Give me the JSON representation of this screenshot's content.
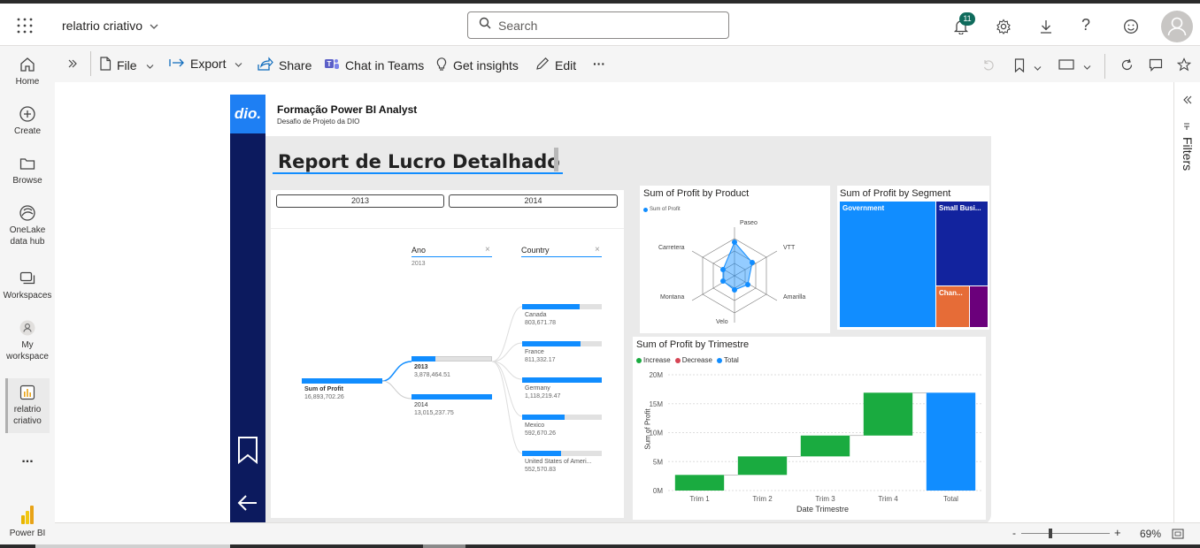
{
  "topbar": {
    "report_name": "relatrio criativo",
    "search_placeholder": "Search",
    "notification_count": "11"
  },
  "nav": {
    "items": [
      {
        "label": "Home"
      },
      {
        "label": "Create"
      },
      {
        "label": "Browse"
      },
      {
        "label": "OneLake data hub"
      },
      {
        "label": "Workspaces"
      },
      {
        "label": "My workspace"
      },
      {
        "label": "relatrio criativo"
      },
      {
        "label": "..."
      }
    ],
    "footer": "Power BI"
  },
  "cmd": {
    "file": "File",
    "export": "Export",
    "share": "Share",
    "chat": "Chat in Teams",
    "insights": "Get insights",
    "edit": "Edit",
    "more": "···"
  },
  "filters": {
    "label": "Filters"
  },
  "status": {
    "zoom": "69%",
    "minus": "-",
    "plus": "+"
  },
  "report": {
    "brand": "dio.",
    "title": "Formação Power BI Analyst",
    "subtitle": "Desafio de Projeto da DIO",
    "heading": "Report de Lucro Detalhado",
    "slicer": {
      "years": [
        "2013",
        "2014"
      ]
    },
    "tree": {
      "root": {
        "label": "Sum of Profit",
        "value": "16,893,702.26"
      },
      "ano_header": "Ano",
      "ano_sub": "2013",
      "country_header": "Country",
      "close": "×",
      "years": [
        {
          "label": "2013",
          "value": "3,878,464.51",
          "frac": 0.3
        },
        {
          "label": "2014",
          "value": "13,015,237.75",
          "frac": 1.0
        }
      ],
      "countries": [
        {
          "label": "Canada",
          "value": "803,671.78",
          "frac": 0.72
        },
        {
          "label": "France",
          "value": "811,332.17",
          "frac": 0.73
        },
        {
          "label": "Germany",
          "value": "1,118,219.47",
          "frac": 1.0
        },
        {
          "label": "Mexico",
          "value": "592,670.26",
          "frac": 0.53
        },
        {
          "label": "United States of Ameri...",
          "value": "552,570.83",
          "frac": 0.49
        }
      ]
    },
    "radar": {
      "title": "Sum of Profit by Product",
      "legend": "Sum of Profit",
      "labels": [
        "Paseo",
        "VTT",
        "Amarilla",
        "Velo",
        "Montana",
        "Carretera"
      ]
    },
    "treemap": {
      "title": "Sum of Profit by Segment",
      "items": [
        "Government",
        "Small Busi...",
        "Chan..."
      ],
      "colors": [
        "#118dff",
        "#12239e",
        "#e66c37",
        "#6b007b"
      ]
    },
    "waterfall": {
      "title": "Sum of Profit by Trimestre",
      "legend": [
        "Increase",
        "Decrease",
        "Total"
      ],
      "legend_colors": [
        "#1aab40",
        "#d64554",
        "#118dff"
      ],
      "ylabel": "Sum of Profit",
      "xlabel": "Date Trimestre",
      "yticks": [
        "20M",
        "15M",
        "10M",
        "5M",
        "0M"
      ]
    }
  },
  "chart_data": {
    "type": "bar",
    "title": "Sum of Profit by Trimestre",
    "xlabel": "Date Trimestre",
    "ylabel": "Sum of Profit",
    "categories": [
      "Trim 1",
      "Trim 2",
      "Trim 3",
      "Trim 4",
      "Total"
    ],
    "series": [
      {
        "name": "Increase",
        "start": [
          0,
          2.7,
          5.9,
          9.5,
          0
        ],
        "end": [
          2.7,
          5.9,
          9.5,
          16.9,
          16.9
        ]
      }
    ],
    "ylim": [
      0,
      20
    ]
  }
}
